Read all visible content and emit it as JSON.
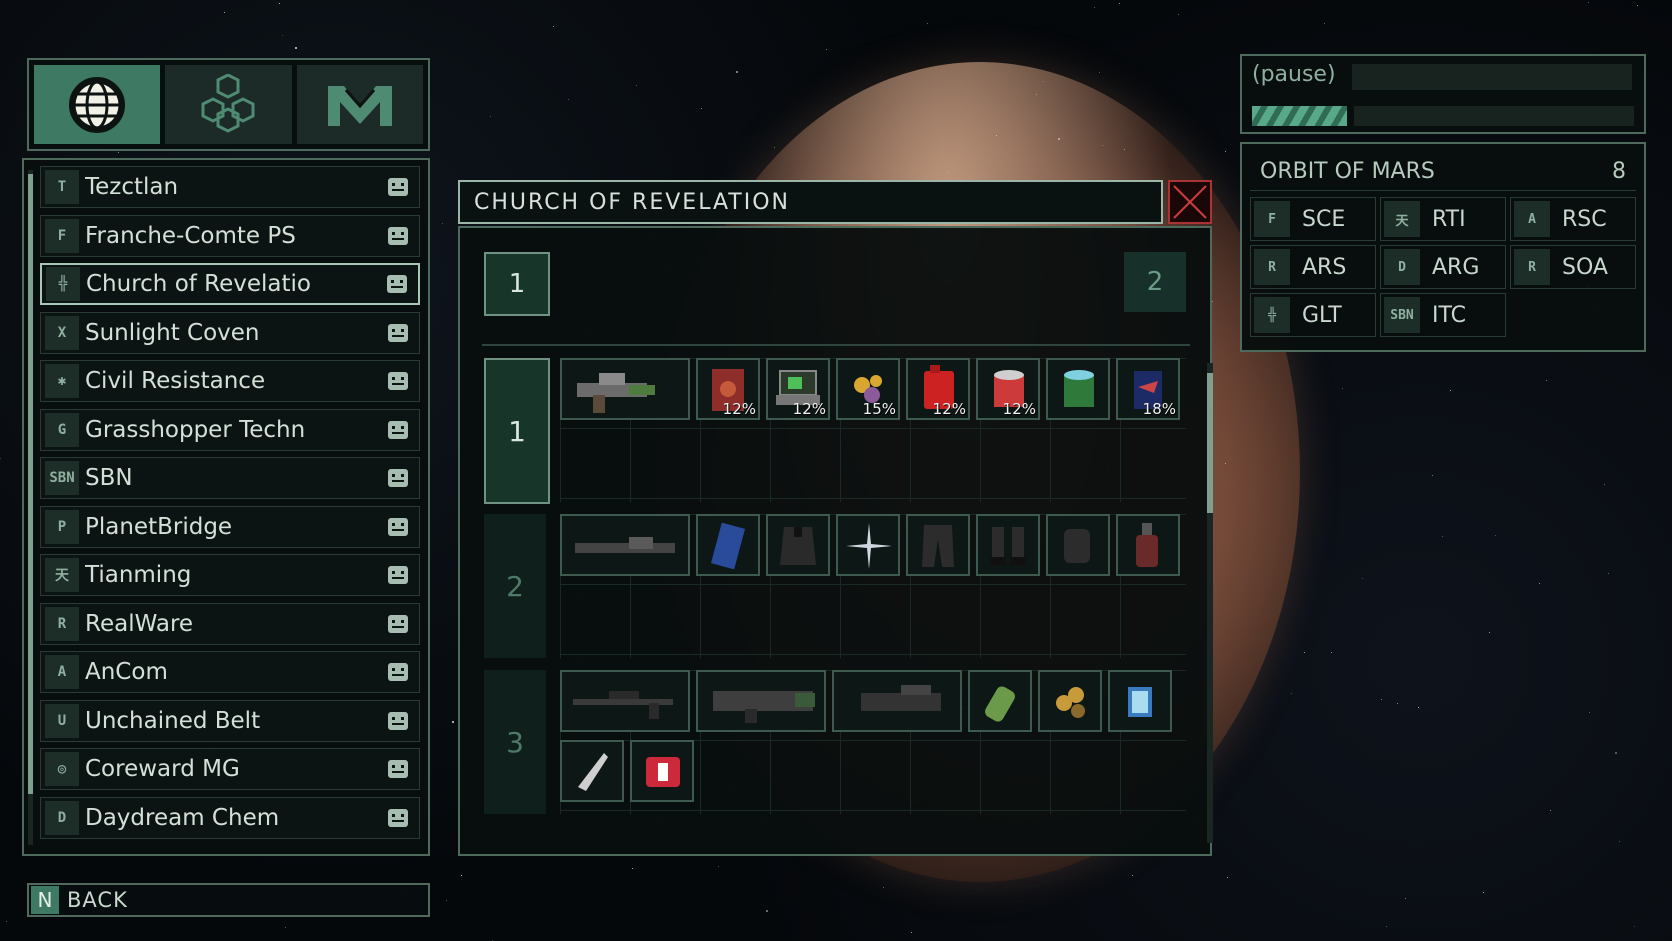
{
  "left_tabs": [
    {
      "icon": "globe-icon",
      "active": true
    },
    {
      "icon": "cubes-icon",
      "active": false
    },
    {
      "icon": "m-logo-icon",
      "active": false
    }
  ],
  "factions": [
    {
      "name": "Tezctlan",
      "icon": "tezctlan-emblem-icon",
      "glyph": "T"
    },
    {
      "name": "Franche-Comte PS",
      "icon": "franche-comte-emblem-icon",
      "glyph": "F"
    },
    {
      "name": "Church of Revelatio",
      "icon": "church-emblem-icon",
      "glyph": "╬",
      "selected": true
    },
    {
      "name": "Sunlight Coven",
      "icon": "sunlight-emblem-icon",
      "glyph": "X"
    },
    {
      "name": "Civil Resistance",
      "icon": "civil-resistance-emblem-icon",
      "glyph": "✱"
    },
    {
      "name": "Grasshopper Techn",
      "icon": "grasshopper-emblem-icon",
      "glyph": "G"
    },
    {
      "name": "SBN",
      "icon": "sbn-emblem-icon",
      "glyph": "SBN"
    },
    {
      "name": "PlanetBridge",
      "icon": "planetbridge-emblem-icon",
      "glyph": "P"
    },
    {
      "name": "Tianming",
      "icon": "tianming-emblem-icon",
      "glyph": "天"
    },
    {
      "name": "RealWare",
      "icon": "realware-emblem-icon",
      "glyph": "R"
    },
    {
      "name": "AnCom",
      "icon": "ancom-emblem-icon",
      "glyph": "A"
    },
    {
      "name": "Unchained Belt",
      "icon": "unchained-emblem-icon",
      "glyph": "U"
    },
    {
      "name": "Coreward MG",
      "icon": "coreward-emblem-icon",
      "glyph": "◎"
    },
    {
      "name": "Daydream Chem",
      "icon": "daydream-emblem-icon",
      "glyph": "D"
    }
  ],
  "back": {
    "key": "N",
    "label": "BACK"
  },
  "dialog": {
    "title": "CHURCH OF REVELATION",
    "tier_tabs": [
      "1",
      "2"
    ],
    "rows": [
      {
        "label": "1",
        "items": [
          {
            "icon": "plasma-pistol-icon",
            "pct": ""
          },
          {
            "icon": "red-book-icon",
            "pct": "12%"
          },
          {
            "icon": "laptop-icon",
            "pct": "12%"
          },
          {
            "icon": "coins-icon",
            "pct": "15%"
          },
          {
            "icon": "fuel-canister-icon",
            "pct": "12%"
          },
          {
            "icon": "food-can-icon",
            "pct": "12%"
          },
          {
            "icon": "green-can-icon",
            "pct": ""
          },
          {
            "icon": "shark-can-icon",
            "pct": "18%"
          }
        ]
      },
      {
        "label": "2",
        "items": [
          {
            "icon": "rifle-barrel-icon"
          },
          {
            "icon": "blue-card-icon"
          },
          {
            "icon": "armor-vest-icon"
          },
          {
            "icon": "sparkle-icon"
          },
          {
            "icon": "pants-icon"
          },
          {
            "icon": "boots-icon"
          },
          {
            "icon": "gloves-icon"
          },
          {
            "icon": "bottle-icon"
          }
        ]
      },
      {
        "label": "3",
        "items": [
          {
            "icon": "sniper-rifle-icon"
          },
          {
            "icon": "heavy-rifle-icon"
          },
          {
            "icon": "launcher-icon"
          },
          {
            "icon": "green-grenade-icon"
          },
          {
            "icon": "ammo-icon"
          },
          {
            "icon": "blue-cube-icon"
          },
          {
            "icon": "knife-icon"
          },
          {
            "icon": "medkit-icon"
          }
        ]
      }
    ]
  },
  "status": {
    "pause_text": "(pause)"
  },
  "orbit": {
    "title": "ORBIT OF MARS",
    "count": "8",
    "stations": [
      {
        "label": "SCE",
        "glyph": "F"
      },
      {
        "label": "RTI",
        "glyph": "天"
      },
      {
        "label": "RSC",
        "glyph": "A"
      },
      {
        "label": "ARS",
        "glyph": "R"
      },
      {
        "label": "ARG",
        "glyph": "D"
      },
      {
        "label": "SOA",
        "glyph": "R"
      },
      {
        "label": "GLT",
        "glyph": "╬"
      },
      {
        "label": "ITC",
        "glyph": "SBN"
      }
    ]
  },
  "colors": {
    "accent": "#3e7a63",
    "border": "#4d6a5d",
    "close": "#aa3333"
  }
}
